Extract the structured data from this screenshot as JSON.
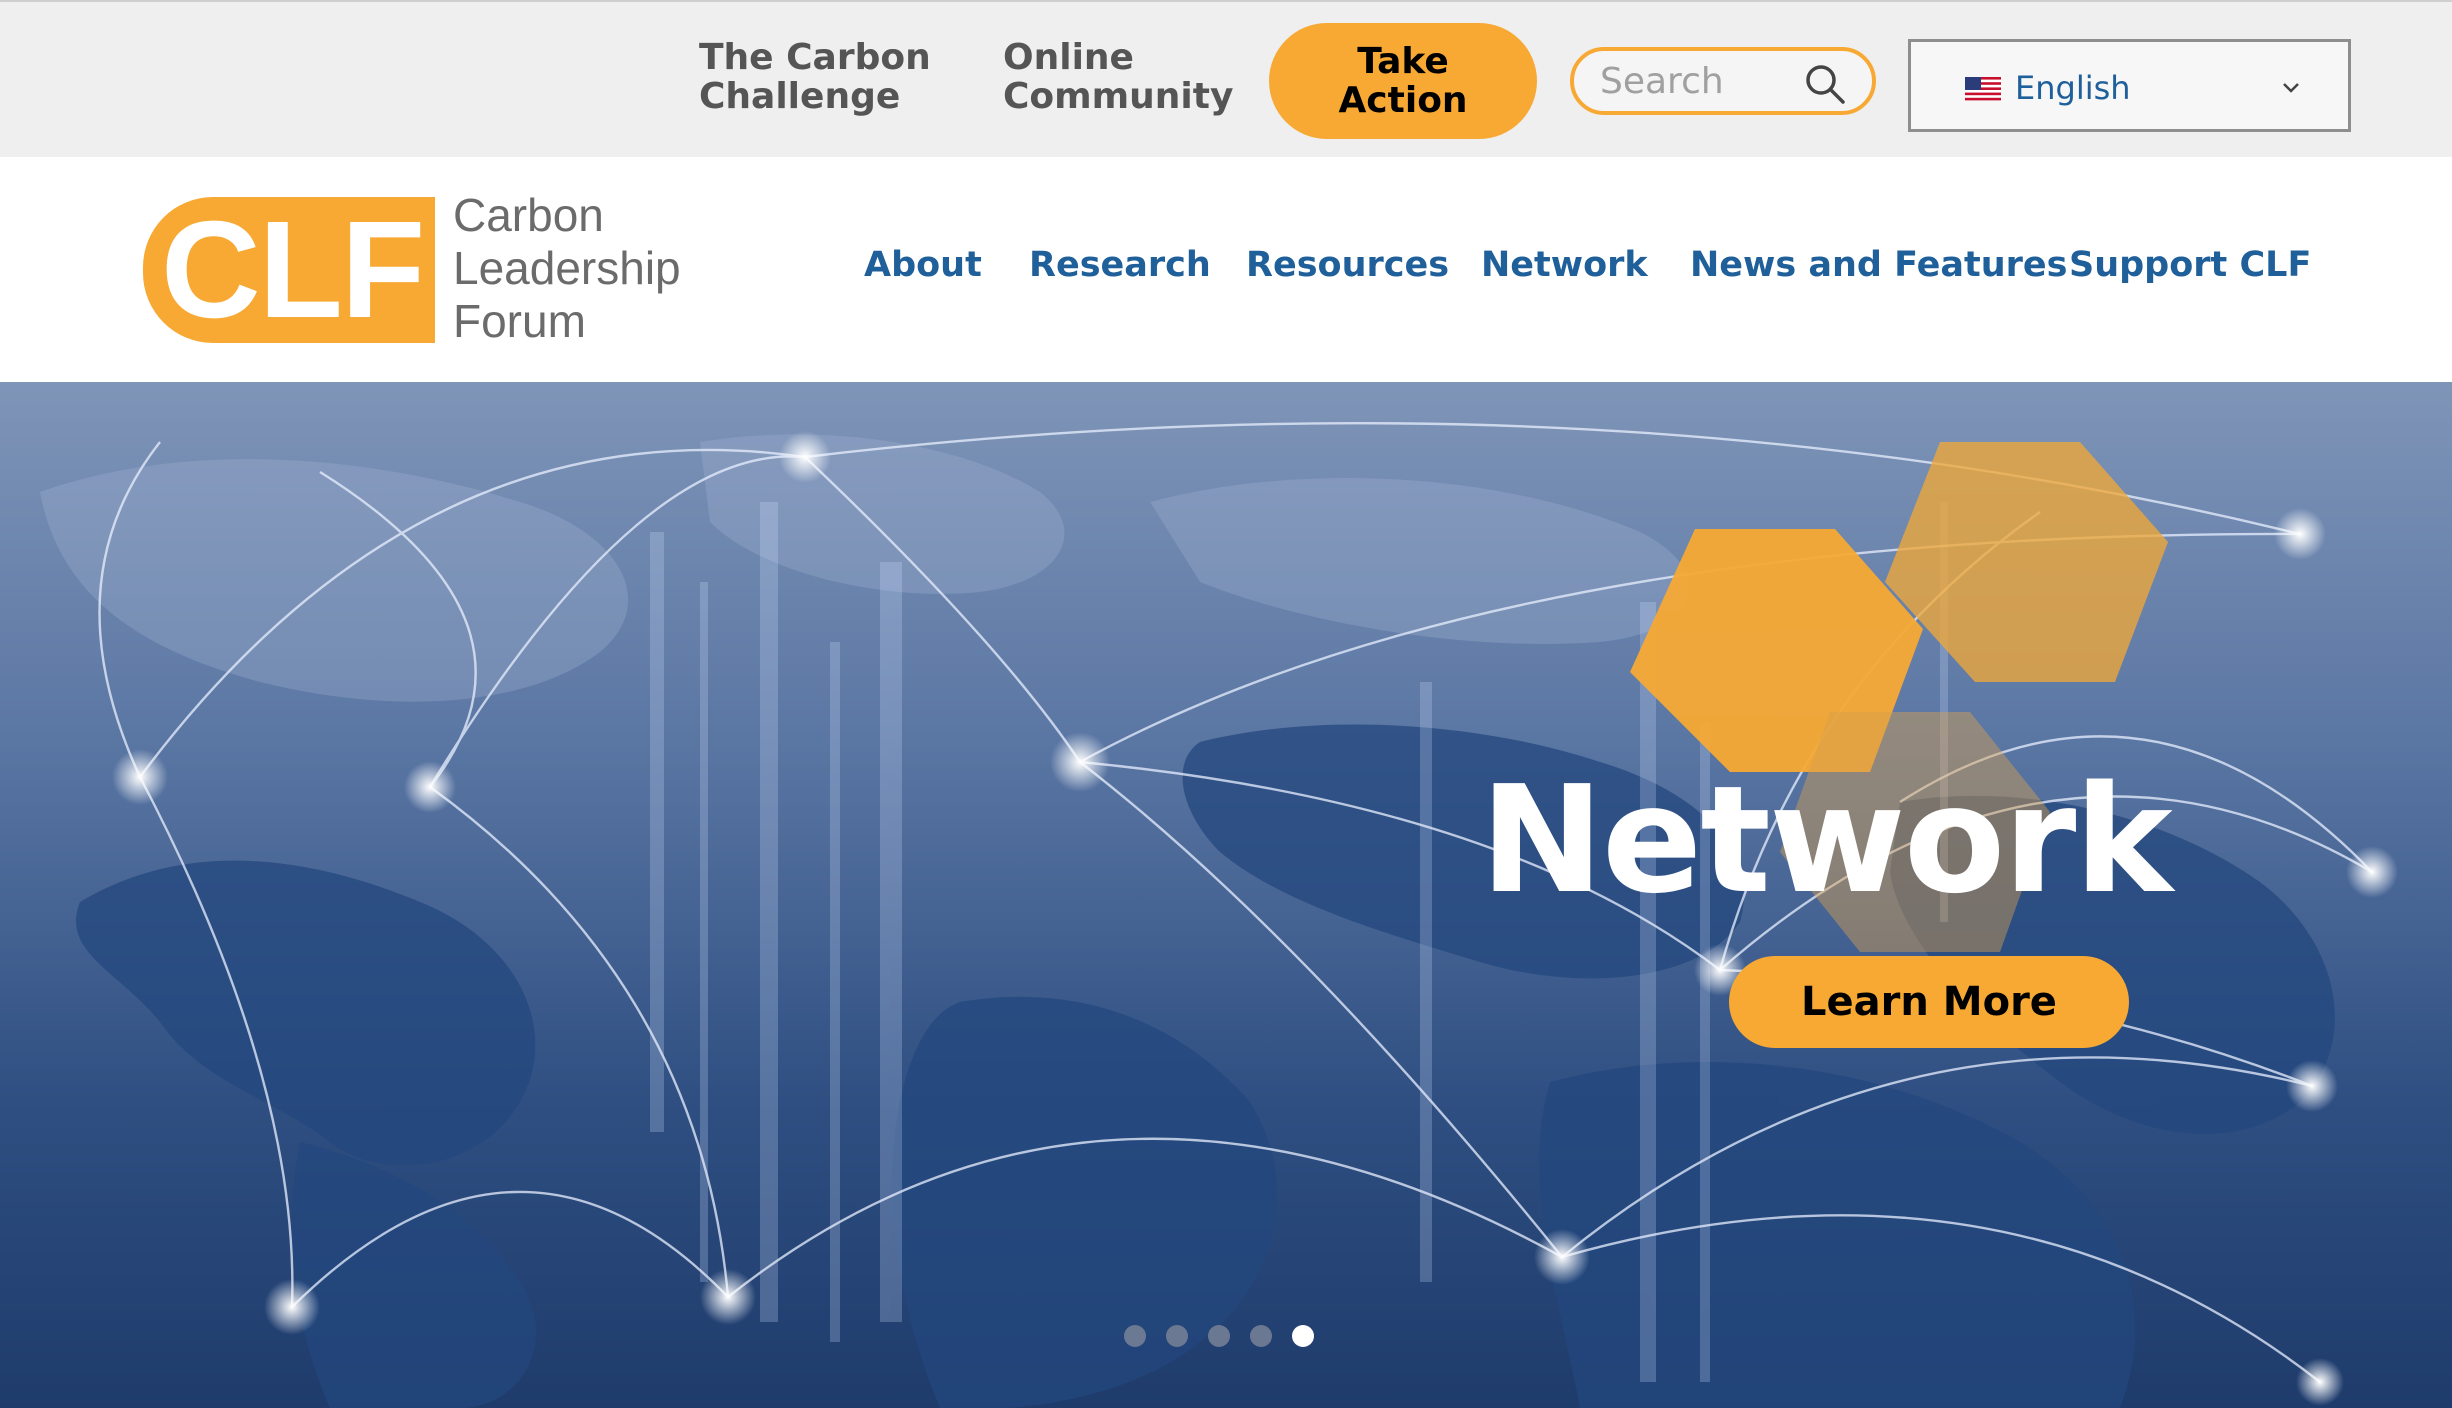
{
  "utility_bar": {
    "links": [
      "The Carbon\nChallenge",
      "Online\nCommunity"
    ],
    "take_action_label": "Take\nAction",
    "search": {
      "placeholder": "Search",
      "value": ""
    },
    "language": {
      "selected": "English",
      "flag_icon": "us-flag-icon",
      "chevron_icon": "chevron-down-icon"
    }
  },
  "logo": {
    "letters": "CLF",
    "words": "Carbon\nLeadership\nForum",
    "brand_color": "#f7a934"
  },
  "nav": {
    "items": [
      "About",
      "Research",
      "Resources",
      "Network",
      "News and Features",
      "Support CLF"
    ],
    "link_color": "#1f5f9a"
  },
  "hero": {
    "title": "Network",
    "cta_label": "Learn More",
    "slides_count": 5,
    "active_slide": 5
  },
  "colors": {
    "accent": "#f7a934",
    "utility_bg": "#efefef",
    "nav_text": "#1f5f9a"
  }
}
